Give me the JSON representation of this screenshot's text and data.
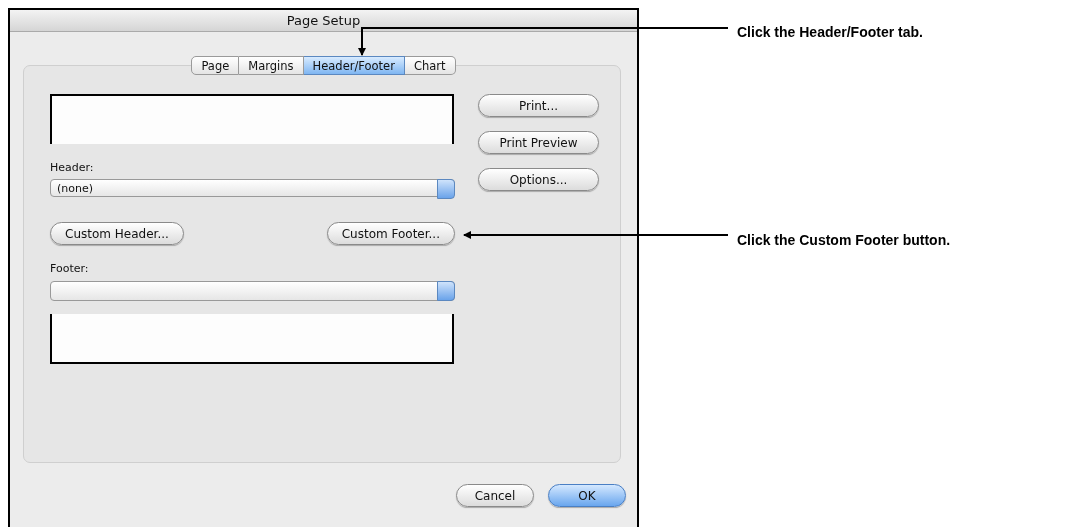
{
  "window": {
    "title": "Page Setup"
  },
  "tabs": [
    {
      "label": "Page",
      "selected": false
    },
    {
      "label": "Margins",
      "selected": false
    },
    {
      "label": "Header/Footer",
      "selected": true
    },
    {
      "label": "Chart",
      "selected": false
    }
  ],
  "header": {
    "label": "Header:",
    "value": "(none)"
  },
  "side_buttons": [
    "Print...",
    "Print Preview",
    "Options..."
  ],
  "custom_buttons": [
    "Custom Header...",
    "Custom Footer..."
  ],
  "footer": {
    "label": "Footer:"
  },
  "dialog_buttons": [
    {
      "label": "Cancel",
      "default": false
    },
    {
      "label": "OK",
      "default": true
    }
  ],
  "callouts": [
    "Click the Header/Footer tab.",
    "Click the Custom Footer button."
  ]
}
